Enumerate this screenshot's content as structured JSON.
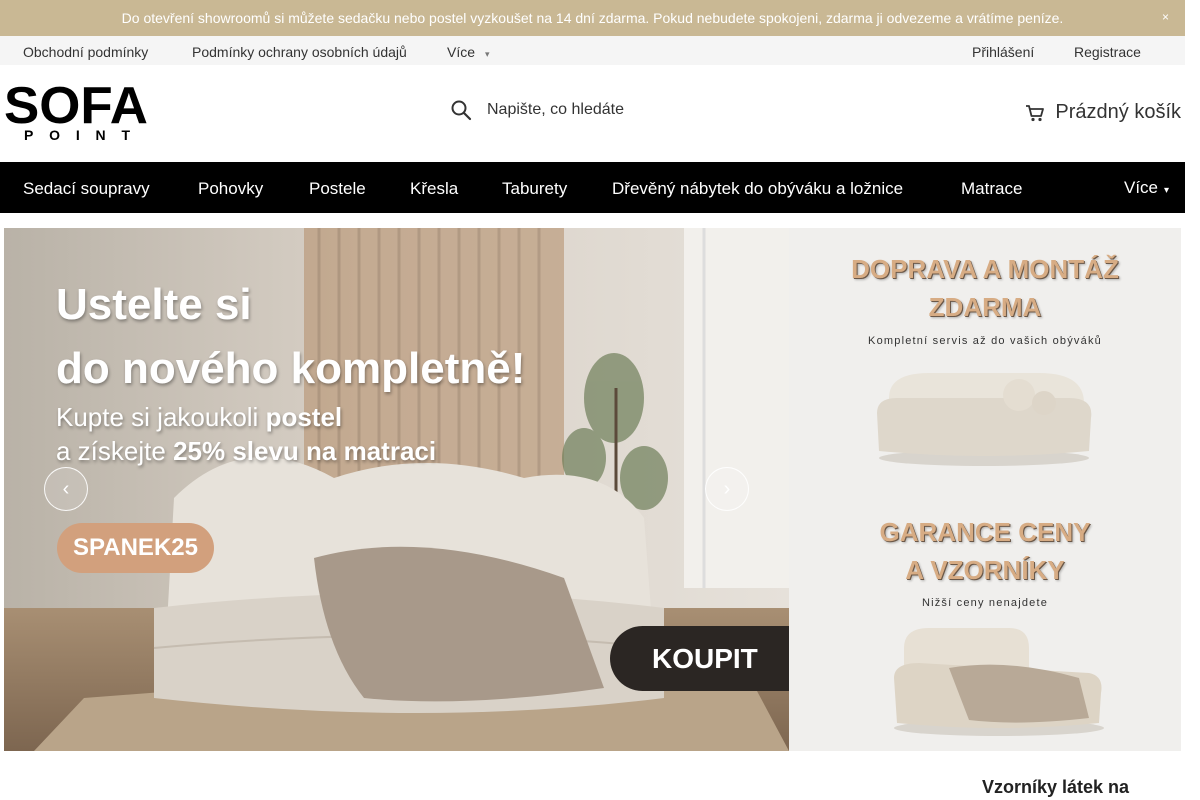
{
  "announcement": {
    "text": "Do otevření showroomů si můžete sedačku nebo postel vyzkoušet na 14 dní zdarma. Pokud nebudete spokojeni, zdarma ji odvezeme a vrátíme peníze.",
    "close_icon": "×"
  },
  "topbar": {
    "links": [
      "Obchodní podmínky",
      "Podmínky ochrany osobních údajů"
    ],
    "more_label": "Více",
    "login": "Přihlášení",
    "register": "Registrace"
  },
  "header": {
    "logo_text": "SOFA",
    "logo_sub": "POINT",
    "search_placeholder": "Napište, co hledáte",
    "search_icon": "search-icon",
    "cart_icon": "cart-icon",
    "cart_label": "Prázdný košík"
  },
  "nav": {
    "items": [
      "Sedací soupravy",
      "Pohovky",
      "Postele",
      "Křesla",
      "Taburety",
      "Dřevěný nábytek do obýváku a ložnice",
      "Matrace"
    ],
    "more_label": "Více"
  },
  "hero": {
    "line1": "Ustelte si",
    "line2": "do nového kompletně!",
    "line3_a": "Kupte si jakoukoli",
    "line3_b": "postel",
    "line4_a": "a získejte",
    "line4_b": "25% slevu na matraci",
    "code": "SPANEK25",
    "buy": "KOUPIT",
    "prev_icon": "chevron-left-icon",
    "next_icon": "chevron-right-icon"
  },
  "side_banner": {
    "block1_line1": "DOPRAVA A MONTÁŽ",
    "block1_line2": "ZDARMA",
    "block1_sub": "Kompletní servis až do vašich obýváků",
    "block2_line1": "GARANCE CENY",
    "block2_line2": "A VZORNÍKY",
    "block2_sub": "Nižší ceny nenajdete"
  },
  "samples_heading": "Vzorníky látek na",
  "colors": {
    "announcement_bg": "#c9b894",
    "nav_bg": "#000000",
    "accent_tan": "#d2a07d",
    "side_title": "#d7ac84"
  }
}
